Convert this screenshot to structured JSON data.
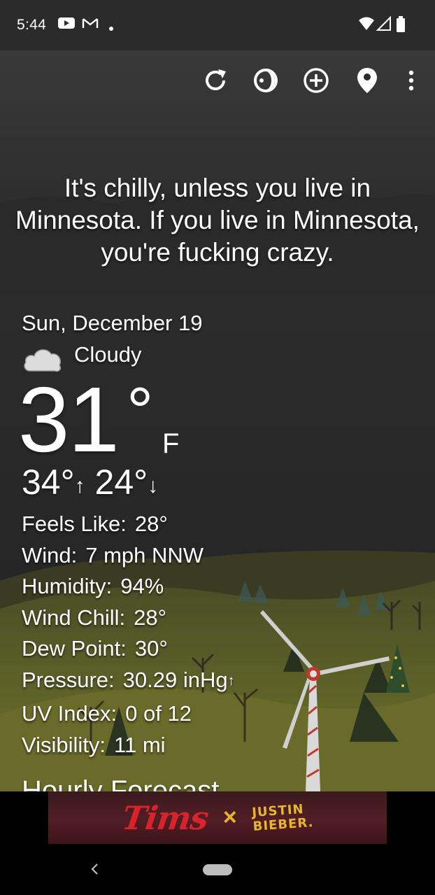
{
  "status_bar": {
    "time": "5:44",
    "icons": [
      "youtube-icon",
      "gmail-icon",
      "dot-icon",
      "wifi-icon",
      "signal-icon",
      "battery-icon"
    ]
  },
  "toolbar": {
    "icons": [
      "refresh-icon",
      "theme-icon",
      "add-location-icon",
      "location-pin-icon",
      "more-vert-icon"
    ]
  },
  "headline": {
    "text": "It's chilly, unless you live in Minnesota. If you live in Minnesota, you're fucking crazy."
  },
  "current": {
    "date": "Sun, December 19",
    "condition": "Cloudy",
    "condition_icon": "cloud-icon",
    "temperature": "31",
    "degree": "°",
    "unit": "F",
    "high": "34°",
    "high_arrow": "↑",
    "low": "24°",
    "low_arrow": "↓"
  },
  "details": [
    {
      "label": "Feels Like:",
      "value": "28°"
    },
    {
      "label": "Wind:",
      "value": "7 mph NNW"
    },
    {
      "label": "Humidity:",
      "value": "94%"
    },
    {
      "label": "Wind Chill:",
      "value": "28°"
    },
    {
      "label": "Dew Point:",
      "value": "30°"
    },
    {
      "label": "Pressure:",
      "value": "30.29 inHg",
      "suffix": "↑"
    },
    {
      "label": "UV Index:",
      "value": "0 of 12"
    },
    {
      "label": "Visibility:",
      "value": "11 mi"
    }
  ],
  "next_section_partial": "Hourly Forecast",
  "ad": {
    "brand": "Tims",
    "separator": "×",
    "partner": "JUSTIN\nBIEBER."
  },
  "nav": {
    "back_icon": "back-chevron-icon",
    "home_icon": "home-pill-icon"
  },
  "colors": {
    "sky": "#3a3a3a",
    "grass": "#6b6e28",
    "ad_red": "#d8232a",
    "ad_gold": "#e9b52c"
  }
}
